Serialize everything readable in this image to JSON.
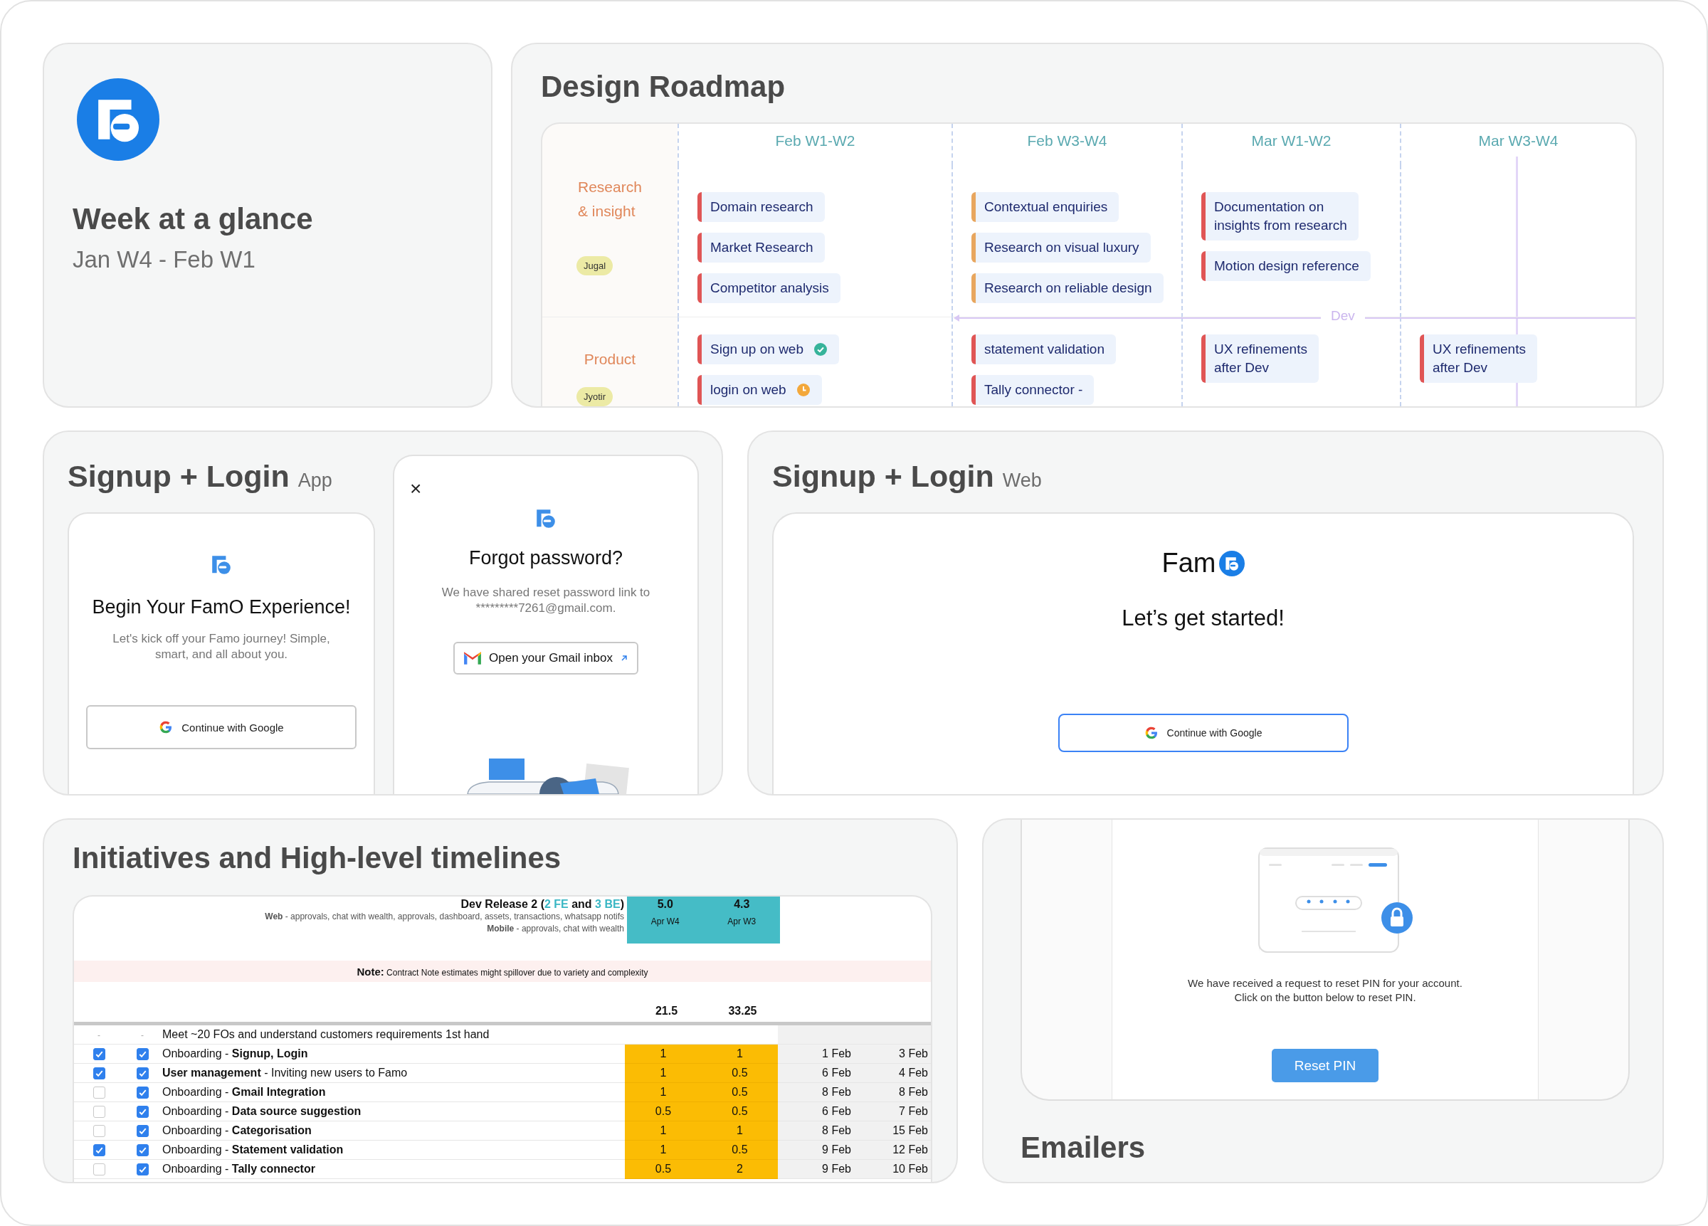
{
  "overview": {
    "title": "Week at a glance",
    "period": "Jan W4 - Feb W1"
  },
  "roadmap": {
    "title": "Design Roadmap",
    "columns": [
      "Feb W1-W2",
      "Feb W3-W4",
      "Mar W1-W2",
      "Mar W3-W4"
    ],
    "marker": {
      "label": "Dev"
    },
    "lanes": [
      {
        "label": "Research & insight",
        "owner": "Jugal",
        "cells": [
          [
            {
              "text": "Domain research",
              "color": "#e05555"
            },
            {
              "text": "Market Research",
              "color": "#e05555"
            },
            {
              "text": "Competitor analysis",
              "color": "#e05555"
            }
          ],
          [
            {
              "text": "Contextual enquiries",
              "color": "#e8a65e"
            },
            {
              "text": "Research on visual luxury",
              "color": "#e8a65e"
            },
            {
              "text": "Research on reliable design",
              "color": "#e8a65e"
            }
          ],
          [
            {
              "text": "Documentation on\ninsights from research",
              "color": "#e05555"
            },
            {
              "text": "Motion design reference",
              "color": "#e05555"
            }
          ],
          []
        ]
      },
      {
        "label": "Product",
        "owner": "Jyotir",
        "cells": [
          [
            {
              "text": "Sign up on web",
              "color": "#e05555",
              "done": true
            },
            {
              "text": "login on web",
              "color": "#e05555",
              "pending": true
            }
          ],
          [
            {
              "text": "statement validation",
              "color": "#e05555"
            },
            {
              "text": "Tally connector -",
              "color": "#e05555"
            }
          ],
          [
            {
              "text": "UX refinements\nafter Dev",
              "color": "#e05555"
            }
          ],
          [
            {
              "text": "UX refinements\nafter Dev",
              "color": "#e05555"
            }
          ]
        ]
      }
    ]
  },
  "app_signup": {
    "title": "Signup + Login",
    "platform": "App",
    "welcome": {
      "heading": "Begin Your FamO Experience!",
      "subtitle": "Let's kick off your Famo journey! Simple,\nsmart, and all about you.",
      "google_button": "Continue with Google"
    },
    "forgot": {
      "close": "×",
      "heading": "Forgot password?",
      "message": "We have shared reset password link to\n*********7261@gmail.com.",
      "gmail_button": "Open your Gmail inbox"
    }
  },
  "web_signup": {
    "title": "Signup + Login",
    "platform": "Web",
    "brand": "Fam",
    "heading": "Let’s get started!",
    "google_button": "Continue with Google"
  },
  "timelines": {
    "title": "Initiatives and High-level timelines",
    "release_title": [
      {
        "text": "Dev Release 2 (",
        "highlight": false
      },
      {
        "text": "2 FE",
        "highlight": true
      },
      {
        "text": " and ",
        "highlight": false
      },
      {
        "text": "3 BE",
        "highlight": true
      },
      {
        "text": ")",
        "highlight": false
      }
    ],
    "web": "**Web** - approvals, chat with wealth, approvals, dashboard, assets, transactions, whatsapp notifs",
    "mobile": "**Mobile** - approvals, chat with wealth",
    "estimates": [
      {
        "value": "5.0",
        "due": "Apr W4"
      },
      {
        "value": "4.3",
        "due": "Apr W3"
      }
    ],
    "note": "**Note:** Contract Note estimates might spillover due to variety and complexity",
    "totals": [
      "21.5",
      "33.25"
    ],
    "rows": [
      {
        "kind": "plain",
        "marks": [
          "-",
          "-"
        ],
        "task": "Meet ~20 FOs and understand customers requirements 1st hand"
      },
      {
        "kind": "task",
        "check_a": true,
        "check_b": true,
        "task": "Onboarding - **Signup, Login**",
        "fe": "1",
        "be": "1",
        "start": "1 Feb",
        "end": "3 Feb"
      },
      {
        "kind": "task",
        "check_a": true,
        "check_b": true,
        "task": "**User management** - Inviting new users to Famo",
        "fe": "1",
        "be": "0.5",
        "start": "6 Feb",
        "end": "4 Feb"
      },
      {
        "kind": "task",
        "check_a": false,
        "check_b": true,
        "task": "Onboarding - **Gmail Integration**",
        "fe": "1",
        "be": "0.5",
        "start": "8 Feb",
        "end": "8 Feb"
      },
      {
        "kind": "task",
        "check_a": false,
        "check_b": true,
        "task": "Onboarding - **Data source suggestion**",
        "fe": "0.5",
        "be": "0.5",
        "start": "6 Feb",
        "end": "7 Feb"
      },
      {
        "kind": "task",
        "check_a": false,
        "check_b": true,
        "task": "Onboarding - **Categorisation**",
        "fe": "1",
        "be": "1",
        "start": "8 Feb",
        "end": "15 Feb"
      },
      {
        "kind": "task",
        "check_a": true,
        "check_b": true,
        "task": "Onboarding - **Statement validation**",
        "fe": "1",
        "be": "0.5",
        "start": "9 Feb",
        "end": "12 Feb"
      },
      {
        "kind": "task",
        "check_a": false,
        "check_b": true,
        "task": "Onboarding - **Tally connector**",
        "fe": "0.5",
        "be": "2",
        "start": "9 Feb",
        "end": "10 Feb"
      }
    ]
  },
  "emailers": {
    "title": "Emailers",
    "message": "We have received a request to reset PIN for your account.\nClick on the button below to reset PIN.",
    "button": "Reset PIN"
  }
}
